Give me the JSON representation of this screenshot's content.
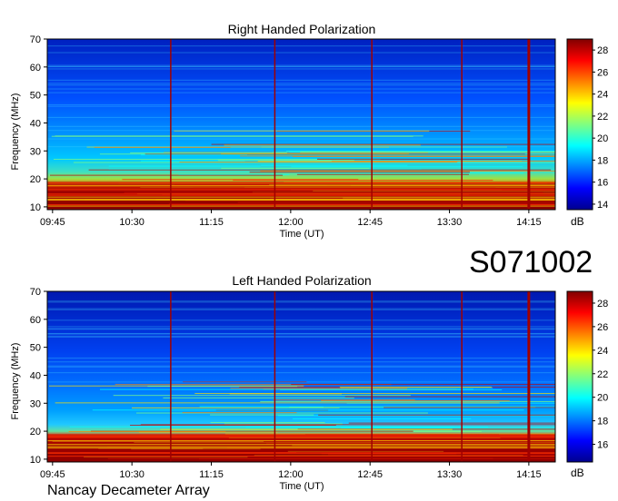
{
  "station_code": "S071002",
  "footer": "Nancay Decameter Array",
  "colorbar_unit": "dB",
  "colormap": [
    "#00008f",
    "#0000ff",
    "#0080ff",
    "#00ffff",
    "#80ff80",
    "#ffff00",
    "#ff8000",
    "#ff0000",
    "#800000"
  ],
  "chart_data": [
    {
      "type": "heatmap",
      "title": "Right Handed Polarization",
      "xlabel": "Time (UT)",
      "ylabel": "Frequency (MHz)",
      "x_ticks": [
        "09:45",
        "10:30",
        "11:15",
        "12:00",
        "12:45",
        "13:30",
        "14:15"
      ],
      "x_range": [
        "09:42",
        "14:30"
      ],
      "y_ticks": [
        10,
        20,
        30,
        40,
        50,
        60,
        70
      ],
      "ylim": [
        9,
        70
      ],
      "colorbar_ticks": [
        14,
        16,
        18,
        20,
        22,
        24,
        26,
        28
      ],
      "colorbar_range": [
        13.5,
        29
      ],
      "interference_lines_utc": [
        "10:52",
        "11:51",
        "12:46",
        "13:37",
        "14:15"
      ]
    },
    {
      "type": "heatmap",
      "title": "Left Handed Polarization",
      "xlabel": "Time (UT)",
      "ylabel": "Frequency (MHz)",
      "x_ticks": [
        "09:45",
        "10:30",
        "11:15",
        "12:00",
        "12:45",
        "13:30",
        "14:15"
      ],
      "x_range": [
        "09:42",
        "14:30"
      ],
      "y_ticks": [
        10,
        20,
        30,
        40,
        50,
        60,
        70
      ],
      "ylim": [
        9,
        70
      ],
      "colorbar_ticks": [
        16,
        18,
        20,
        22,
        24,
        26,
        28
      ],
      "colorbar_range": [
        14.5,
        29
      ],
      "interference_lines_utc": [
        "10:52",
        "11:51",
        "12:46",
        "13:37",
        "14:15"
      ]
    }
  ]
}
